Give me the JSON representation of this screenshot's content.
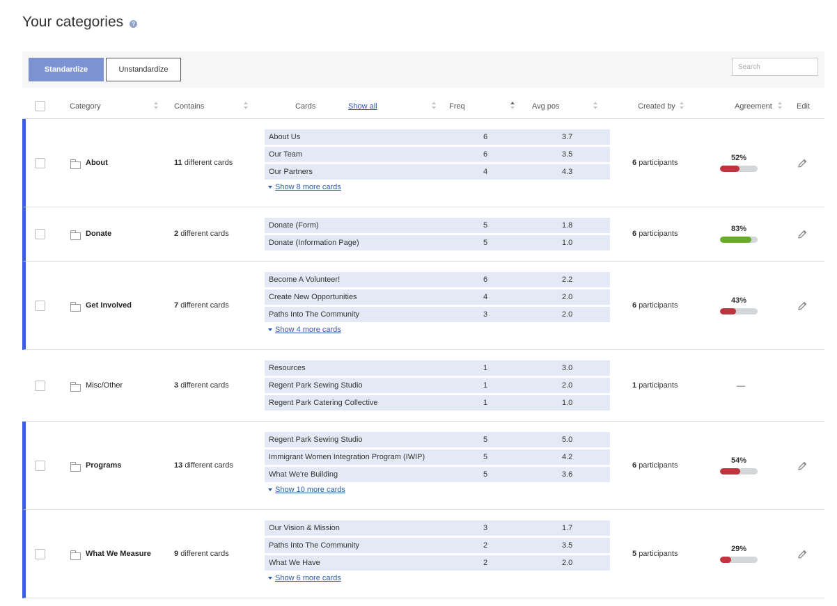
{
  "page": {
    "title": "Your categories",
    "help_icon": "question-circle-icon"
  },
  "toolbar": {
    "standardize_label": "Standardize",
    "unstandardize_label": "Unstandardize",
    "search_placeholder": "Search"
  },
  "table": {
    "headers": {
      "category": "Category",
      "contains": "Contains",
      "cards": "Cards",
      "show_all": "Show all",
      "freq": "Freq",
      "avg_pos": "Avg pos",
      "created_by": "Created by",
      "agreement": "Agreement",
      "edit": "Edit"
    },
    "colors": {
      "standardized_accent": "#3a5fd9",
      "bar_low": "#c0343f",
      "bar_high": "#6aac2a",
      "card_bg": "#e3eaf6",
      "link": "#2a5aa8"
    },
    "rows": [
      {
        "name": "About",
        "standardized": true,
        "count": "11",
        "count_suffix": "different cards",
        "cards": [
          {
            "name": "About Us",
            "freq": "6",
            "avg": "3.7"
          },
          {
            "name": "Our Team",
            "freq": "6",
            "avg": "3.5"
          },
          {
            "name": "Our Partners",
            "freq": "4",
            "avg": "4.3"
          }
        ],
        "show_more": "Show 8 more cards",
        "participants": "6",
        "participants_suffix": "participants",
        "agreement": "52%",
        "agreement_fraction": 0.52,
        "bar_color": "#c0343f"
      },
      {
        "name": "Donate",
        "standardized": true,
        "count": "2",
        "count_suffix": "different cards",
        "cards": [
          {
            "name": "Donate (Form)",
            "freq": "5",
            "avg": "1.8"
          },
          {
            "name": "Donate (Information Page)",
            "freq": "5",
            "avg": "1.0"
          }
        ],
        "show_more": "",
        "participants": "6",
        "participants_suffix": "participants",
        "agreement": "83%",
        "agreement_fraction": 0.83,
        "bar_color": "#6aac2a"
      },
      {
        "name": "Get Involved",
        "standardized": true,
        "count": "7",
        "count_suffix": "different cards",
        "cards": [
          {
            "name": "Become A Volunteer!",
            "freq": "6",
            "avg": "2.2"
          },
          {
            "name": "Create New Opportunities",
            "freq": "4",
            "avg": "2.0"
          },
          {
            "name": "Paths Into The Community",
            "freq": "3",
            "avg": "2.0"
          }
        ],
        "show_more": "Show 4 more cards",
        "participants": "6",
        "participants_suffix": "participants",
        "agreement": "43%",
        "agreement_fraction": 0.43,
        "bar_color": "#c0343f"
      },
      {
        "name": "Misc/Other",
        "standardized": false,
        "count": "3",
        "count_suffix": "different cards",
        "cards": [
          {
            "name": "Resources",
            "freq": "1",
            "avg": "3.0"
          },
          {
            "name": "Regent Park Sewing Studio",
            "freq": "1",
            "avg": "2.0"
          },
          {
            "name": "Regent Park Catering Collective",
            "freq": "1",
            "avg": "1.0"
          }
        ],
        "show_more": "",
        "participants": "1",
        "participants_suffix": "participants",
        "agreement": "—",
        "agreement_fraction": null,
        "bar_color": ""
      },
      {
        "name": "Programs",
        "standardized": true,
        "count": "13",
        "count_suffix": "different cards",
        "cards": [
          {
            "name": "Regent Park Sewing Studio",
            "freq": "5",
            "avg": "5.0"
          },
          {
            "name": "Immigrant Women Integration Program (IWIP)",
            "freq": "5",
            "avg": "4.2"
          },
          {
            "name": "What We're Building",
            "freq": "5",
            "avg": "3.6"
          }
        ],
        "show_more": "Show 10 more cards",
        "participants": "6",
        "participants_suffix": "participants",
        "agreement": "54%",
        "agreement_fraction": 0.54,
        "bar_color": "#c0343f"
      },
      {
        "name": "What We Measure",
        "standardized": true,
        "count": "9",
        "count_suffix": "different cards",
        "cards": [
          {
            "name": "Our Vision & Mission",
            "freq": "3",
            "avg": "1.7"
          },
          {
            "name": "Paths Into The Community",
            "freq": "2",
            "avg": "3.5"
          },
          {
            "name": "What We Have",
            "freq": "2",
            "avg": "2.0"
          }
        ],
        "show_more": "Show 6 more cards",
        "participants": "5",
        "participants_suffix": "participants",
        "agreement": "29%",
        "agreement_fraction": 0.29,
        "bar_color": "#c0343f"
      }
    ]
  }
}
